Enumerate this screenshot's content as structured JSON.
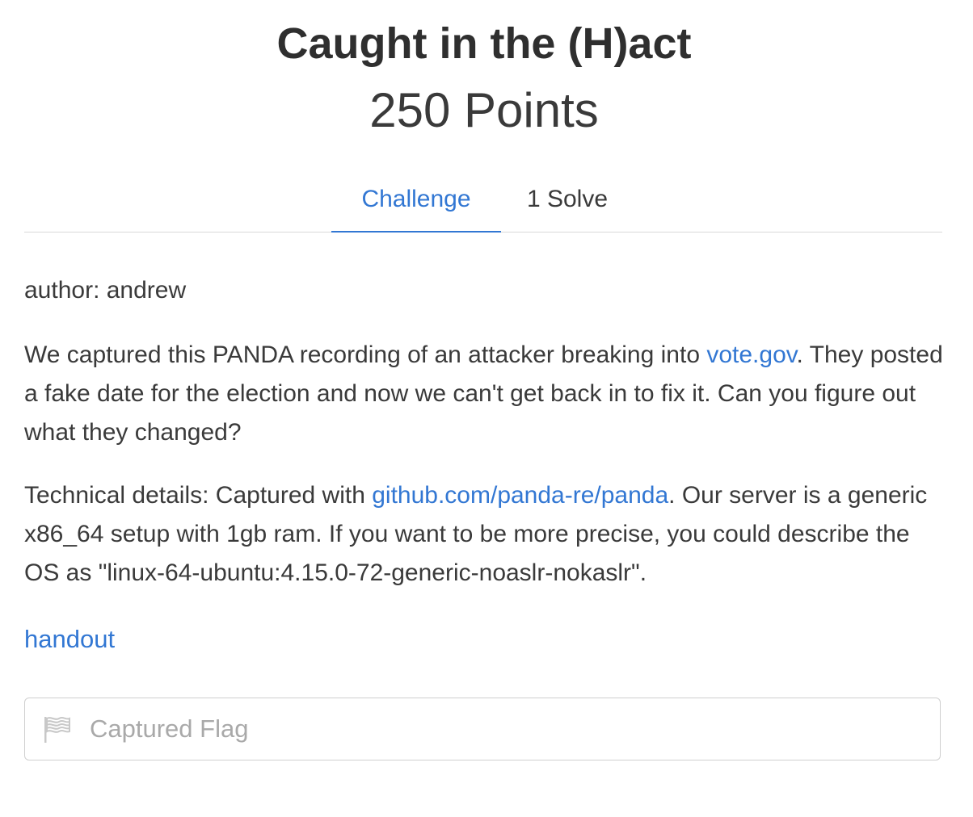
{
  "challenge": {
    "title": "Caught in the (H)act",
    "points": "250 Points"
  },
  "tabs": [
    {
      "label": "Challenge",
      "active": true
    },
    {
      "label": "1 Solve",
      "active": false
    }
  ],
  "description": {
    "author": "author: andrew",
    "p1_before": "We captured this PANDA recording of an attacker breaking into ",
    "p1_link": "vote.gov",
    "p1_after": ". They posted a fake date for the election and now we can't get back in to fix it. Can you figure out what they changed?",
    "p2_before": "Technical details: Captured with ",
    "p2_link": "github.com/panda-re/panda",
    "p2_after": ". Our server is a generic x86_64 setup with 1gb ram. If you want to be more precise, you could describe the OS as \"linux-64-ubuntu:4.15.0-72-generic-noaslr-nokaslr\"."
  },
  "handout": {
    "label": "handout"
  },
  "flag_input": {
    "placeholder": "Captured Flag",
    "value": "",
    "icon": "flag-icon"
  },
  "colors": {
    "accent": "#3277d3",
    "text": "#3a3a3a",
    "placeholder": "#a9a9a9",
    "border": "#cfcfcf"
  }
}
